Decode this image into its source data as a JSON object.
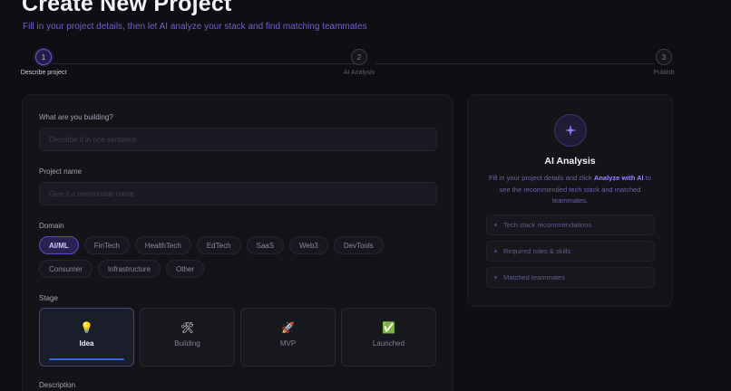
{
  "header": {
    "title": "Create New Project",
    "subtitle": "Fill in your project details, then let AI analyze your stack and find matching teammates"
  },
  "stepper": {
    "steps": [
      {
        "number": "1",
        "label": "Describe project"
      },
      {
        "number": "2",
        "label": "AI Analysis"
      },
      {
        "number": "3",
        "label": "Publish"
      }
    ],
    "active_step": 1
  },
  "form": {
    "building": {
      "label": "What are you building?",
      "placeholder": "Describe it in one sentence",
      "value": ""
    },
    "name": {
      "label": "Project name",
      "placeholder": "Give it a memorable name",
      "value": ""
    },
    "domain": {
      "label": "Domain",
      "options": [
        "AI/ML",
        "FinTech",
        "HealthTech",
        "EdTech",
        "SaaS",
        "Web3",
        "DevTools",
        "Consumer",
        "Infrastructure",
        "Other"
      ],
      "selected": "AI/ML"
    },
    "stage": {
      "label": "Stage",
      "options": [
        {
          "icon": "💡",
          "icon_name": "lightbulb-icon",
          "label": "Idea"
        },
        {
          "icon": "🛠",
          "icon_name": "tools-icon",
          "label": "Building"
        },
        {
          "icon": "🚀",
          "icon_name": "rocket-icon",
          "label": "MVP"
        },
        {
          "icon": "✅",
          "icon_name": "checkmark-icon",
          "label": "Launched"
        }
      ],
      "selected": "Idea"
    },
    "description": {
      "label": "Description"
    }
  },
  "ai_panel": {
    "title": "AI Analysis",
    "desc_before": "Fill in your project details and click ",
    "desc_link": "Analyze with AI",
    "desc_after": " to see the recommended tech stack and matched teammates.",
    "items": [
      "Tech stack recommendations",
      "Required roles & skills",
      "Matched teammates"
    ]
  },
  "colors": {
    "background": "#0e0e13",
    "accent": "#6c55d9",
    "selected_bar": "#3e63d8"
  }
}
